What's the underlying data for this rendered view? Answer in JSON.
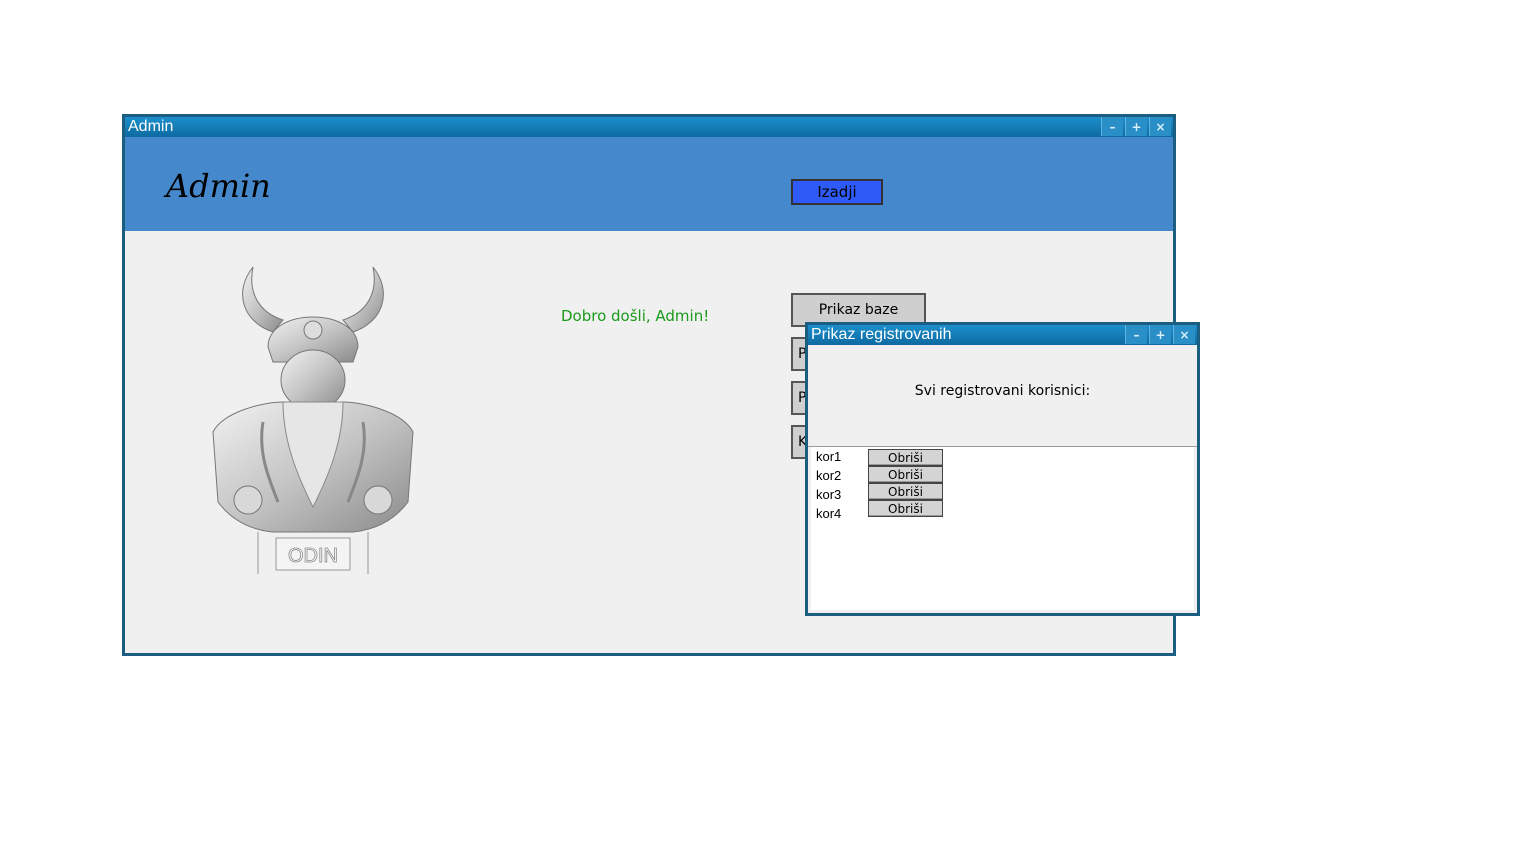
{
  "admin_window": {
    "title": "Admin",
    "controls": {
      "minimize": "–",
      "maximize": "+",
      "close": "×"
    },
    "header_title": "Admin",
    "exit_button": "Izadji",
    "welcome": "Dobro došli, Admin!",
    "side_buttons": [
      "Prikaz baze",
      "P",
      "Pr",
      "K"
    ],
    "bust_label": "ODIN"
  },
  "dialog": {
    "title": "Prikaz registrovanih",
    "controls": {
      "minimize": "–",
      "maximize": "+",
      "close": "×"
    },
    "heading": "Svi registrovani korisnici:",
    "users": [
      "kor1",
      "kor2",
      "kor3",
      "kor4"
    ],
    "delete_label": "Obriši"
  },
  "colors": {
    "title_bar": "#1c8fcc",
    "header_band": "#4589cc",
    "exit_button": "#2e5bf7",
    "welcome_text": "#1a9a1a"
  }
}
